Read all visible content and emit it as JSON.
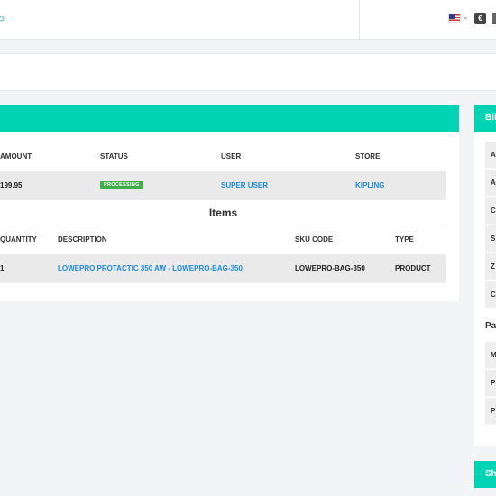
{
  "topbar": {
    "flag_icon": "us-flag-icon",
    "currency_symbol": "€"
  },
  "order": {
    "columns": [
      "AMOUNT",
      "STATUS",
      "USER",
      "STORE"
    ],
    "amount": "199.95",
    "status": "PROCESSING",
    "user": "SUPER USER",
    "store": "KIPLING"
  },
  "items": {
    "title": "Items",
    "columns": [
      "QUANTITY",
      "DESCRIPTION",
      "SKU CODE",
      "TYPE"
    ],
    "rows": [
      {
        "quantity": "1",
        "description": "LOWEPRO PROTACTIC 350 AW - LOWEPRO-BAG-350",
        "sku": "LOWEPRO-BAG-350",
        "type": "PRODUCT"
      }
    ]
  },
  "billing": {
    "title": "Bil",
    "rows": [
      "A",
      "A",
      "C",
      "S",
      "Z",
      "C"
    ],
    "payment_title": "Pa",
    "payment_rows": [
      "M",
      "P",
      "P"
    ]
  },
  "shipping": {
    "title": "Sh"
  },
  "colors": {
    "accent": "#00d4b4",
    "link": "#1e88e5",
    "status_processing": "#3fae49"
  }
}
